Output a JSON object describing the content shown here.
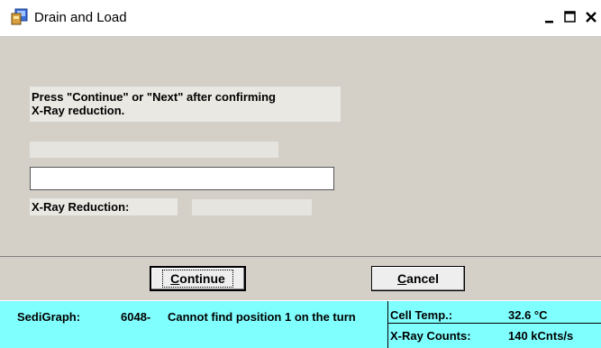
{
  "window": {
    "title": "Drain and Load",
    "controls": {
      "minimize": "_",
      "maximize": "□",
      "close": "×"
    }
  },
  "content": {
    "instruction": "Press \"Continue\" or \"Next\" after confirming\nX-Ray reduction.",
    "text_input_value": "",
    "xray_reduction_label": "X-Ray Reduction:",
    "xray_reduction_value": ""
  },
  "buttons": {
    "continue_prefix": "",
    "continue_mnemonic": "C",
    "continue_rest": "ontinue",
    "cancel_mnemonic": "C",
    "cancel_rest": "ancel"
  },
  "status": {
    "source": "SediGraph:",
    "code": "6048-",
    "message": "Cannot find position 1 on the turn",
    "cell_temp_label": "Cell Temp.:",
    "cell_temp_value": "32.6 °C",
    "xray_counts_label": "X-Ray Counts:",
    "xray_counts_value": "140 kCnts/s"
  },
  "colors": {
    "status_bar": "#80ffff",
    "dialog_face": "#d4d0c8"
  }
}
